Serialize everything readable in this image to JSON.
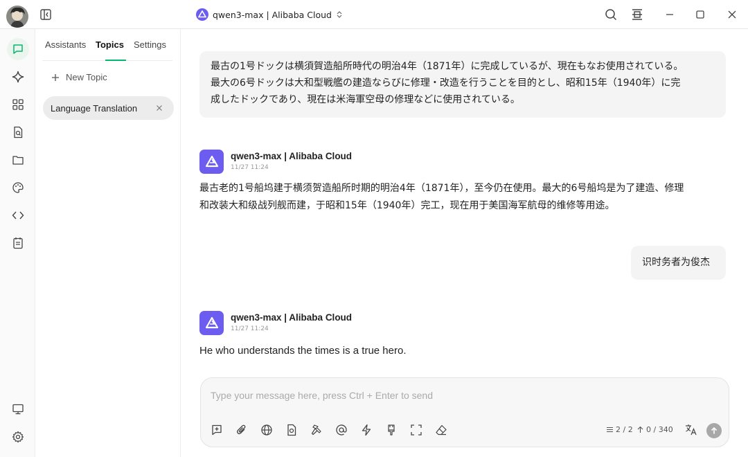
{
  "window": {
    "model_title": "qwen3-max | Alibaba Cloud"
  },
  "sidebar": {
    "tabs": [
      {
        "label": "Assistants"
      },
      {
        "label": "Topics",
        "active": true
      },
      {
        "label": "Settings"
      }
    ],
    "new_topic_label": "New Topic",
    "topics": [
      {
        "label": "Language Translation",
        "active": true
      }
    ]
  },
  "chat": {
    "messages": [
      {
        "role": "user",
        "lines": [
          "最古の1号ドックは横須賀造船所時代の明治4年（1871年）に完成しているが、現在もなお使用されている。",
          "最大の6号ドックは大和型戦艦の建造ならびに修理・改造を行うことを目的とし、昭和15年（1940年）に完",
          "成したドックであり、現在は米海軍空母の修理などに使用されている。"
        ]
      },
      {
        "role": "assistant",
        "name": "qwen3-max | Alibaba Cloud",
        "time": "11/27 11:24",
        "lines": [
          "最古老的1号船坞建于横须贺造船所时期的明治4年（1871年），至今仍在使用。最大的6号船坞是为了建造、修理",
          "和改装大和级战列舰而建，于昭和15年（1940年）完工，现在用于美国海军航母的维修等用途。"
        ]
      },
      {
        "role": "user",
        "lines": [
          "识时务者为俊杰"
        ]
      },
      {
        "role": "assistant",
        "name": "qwen3-max | Alibaba Cloud",
        "time": "11/27 11:24",
        "lines": [
          "He who understands the times is a true hero."
        ]
      }
    ]
  },
  "composer": {
    "placeholder": "Type your message here, press Ctrl + Enter to send",
    "context_count": "2 / 2",
    "token_count": "0 / 340"
  },
  "colors": {
    "accent": "#00b96b",
    "model_brand": "#6d5cf0"
  }
}
